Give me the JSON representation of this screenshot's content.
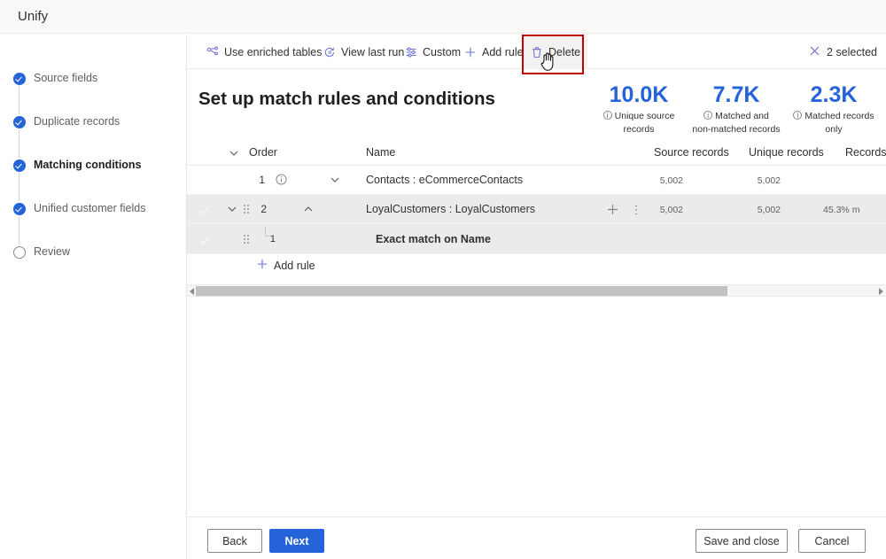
{
  "app": {
    "title": "Unify"
  },
  "sidebar": {
    "items": [
      {
        "label": "Source fields",
        "state": "done"
      },
      {
        "label": "Duplicate records",
        "state": "done"
      },
      {
        "label": "Matching conditions",
        "state": "done",
        "current": true
      },
      {
        "label": "Unified customer fields",
        "state": "done"
      },
      {
        "label": "Review",
        "state": "todo"
      }
    ]
  },
  "toolbar": {
    "commands": [
      {
        "label": "Use enriched tables",
        "icon": "enriched-tables-icon"
      },
      {
        "label": "View last run",
        "icon": "history-icon"
      },
      {
        "label": "Custom",
        "icon": "sliders-icon"
      },
      {
        "label": "Add rule",
        "icon": "plus-icon"
      },
      {
        "label": "Delete",
        "icon": "trash-icon"
      }
    ],
    "selection": {
      "label": "2 selected",
      "icon": "close-icon"
    }
  },
  "page": {
    "title": "Set up match rules and conditions"
  },
  "kpis": [
    {
      "value": "10.0K",
      "label_line1": "Unique source",
      "label_line2": "records"
    },
    {
      "value": "7.7K",
      "label_line1": "Matched and",
      "label_line2": "non-matched records"
    },
    {
      "value": "2.3K",
      "label_line1": "Matched records",
      "label_line2": "only"
    }
  ],
  "table": {
    "headers": {
      "order": "Order",
      "name": "Name",
      "source_records": "Source records",
      "unique_records": "Unique records",
      "records": "Records"
    },
    "rows": [
      {
        "selected": false,
        "order": "1",
        "name": "Contacts : eCommerceContacts",
        "source_records": "5,002",
        "unique_records": "5,002",
        "records": ""
      },
      {
        "selected": true,
        "order": "2",
        "name": "LoyalCustomers : LoyalCustomers",
        "source_records": "5,002",
        "unique_records": "5,002",
        "records": "45.3% m"
      }
    ],
    "subrow": {
      "selected": true,
      "order": "1",
      "name": "Exact match on Name"
    },
    "add_rule_label": "Add rule"
  },
  "footer": {
    "back": "Back",
    "next": "Next",
    "save_and_close": "Save and close",
    "cancel": "Cancel"
  },
  "colors": {
    "accent": "#2563d9",
    "highlight_box": "#c00000",
    "row_selected": "#ebebeb"
  }
}
